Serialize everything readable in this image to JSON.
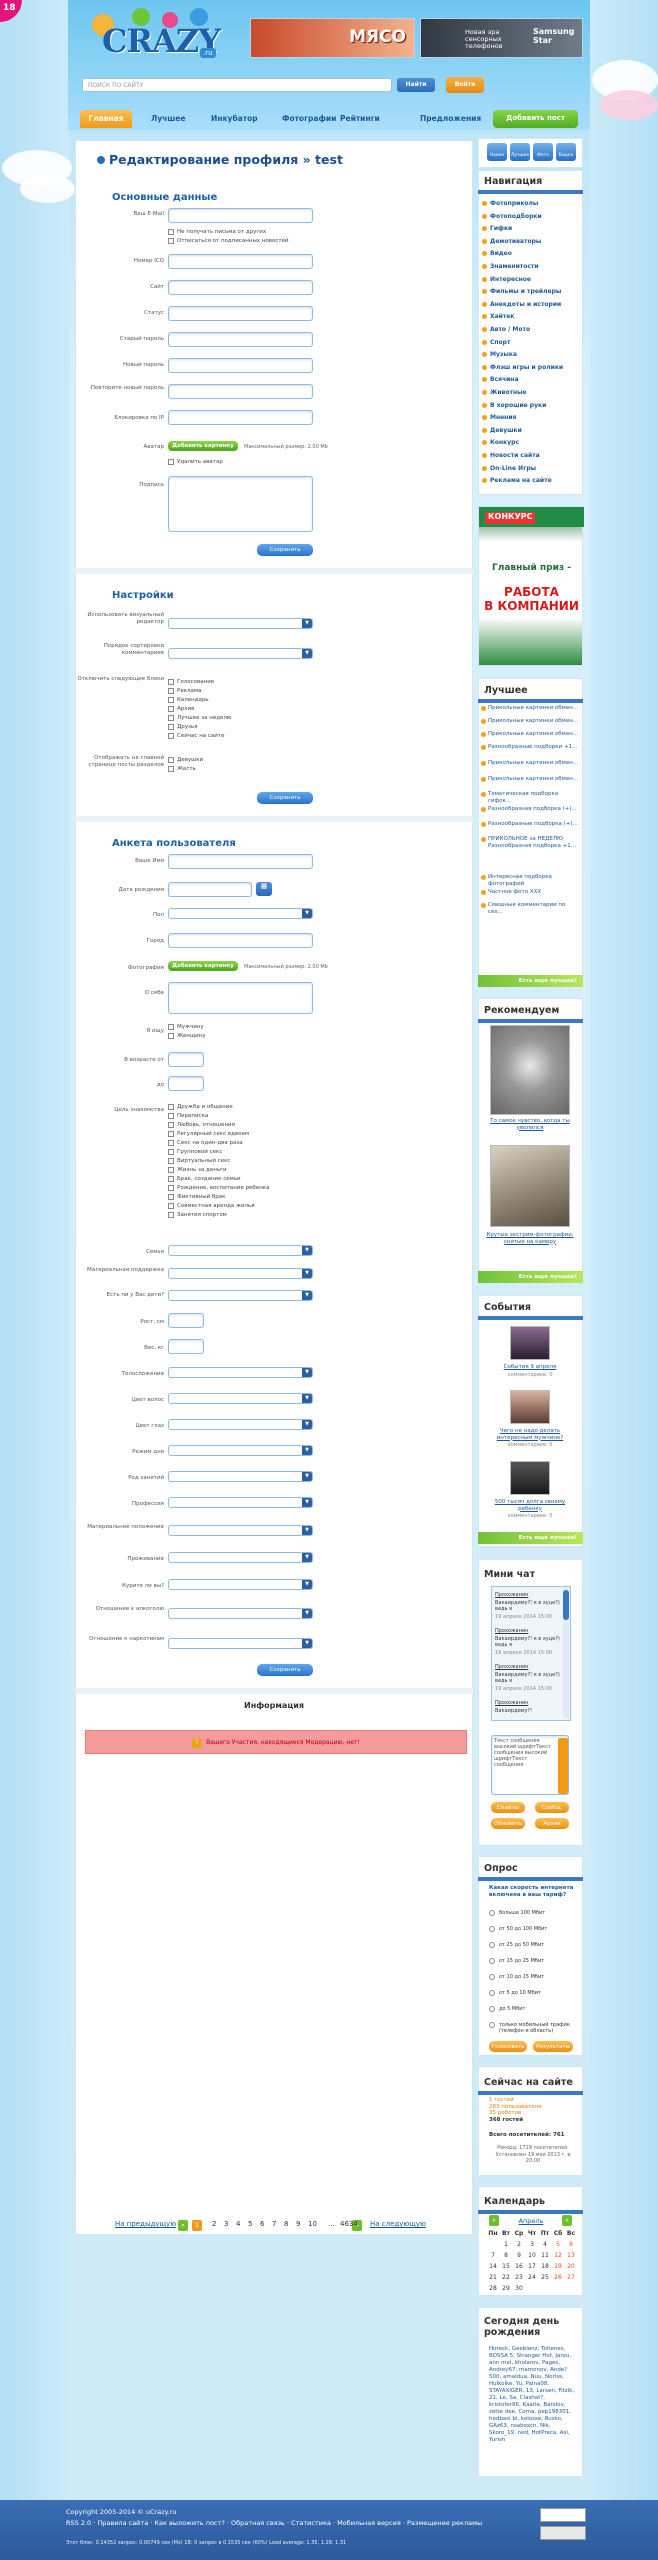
{
  "age_badge": "18",
  "site": {
    "logo": "CRAZY",
    "logo_suffix": ".ru",
    "logo_prefix": "u"
  },
  "ads": {
    "banner1": "МЯСО",
    "banner2_text": "Новая эра\nсенсорных телефонов",
    "banner2_brand": "Samsung\nStar"
  },
  "search": {
    "placeholder": "ПОИСК ПО САЙТУ",
    "find": "Найти"
  },
  "login_button": "Войти",
  "nav": {
    "items": [
      "Главная",
      "Лучшее",
      "Инкубатор",
      "Фотографии",
      "Рейтинги",
      "Предложения"
    ],
    "add_post": "Добавить пост"
  },
  "page": {
    "title": "Редактирование профиля » test",
    "save": "Сохранить"
  },
  "basic": {
    "heading": "Основные данные",
    "labels": [
      "Ваш E-Mail",
      "Номер ICQ",
      "Сайт",
      "Статус",
      "Старый пароль",
      "Новый пароль",
      "Повторите новый пароль",
      "Блокировка по IP",
      "Аватар",
      "Подпись"
    ],
    "checks": [
      "Не получать письма от других",
      "Отписаться от подписанных новостей"
    ],
    "add_photo": "Добавить картинку",
    "max_size": "Максимальный размер: 2.00 Mb",
    "delete_avatar": "Удалить аватар"
  },
  "settings": {
    "heading": "Настройки",
    "labels": [
      "Использовать визуальный редактор",
      "Порядок сортировки комментариев",
      "Отключить следующие блоки",
      "Отображать на главной странице посты разделов"
    ],
    "blocks": [
      "Голосование",
      "Реклама",
      "Календарь",
      "Архив",
      "Лучшее за неделю",
      "Друзья",
      "Сейчас на сайте"
    ],
    "sections": [
      "Девушки",
      "Жесть"
    ]
  },
  "questionnaire": {
    "heading": "Анкета пользователя",
    "labels": [
      "Ваше Имя",
      "Дата рождения",
      "Пол",
      "Город",
      "Фотография",
      "О себе",
      "Я ищу",
      "В возрасте от",
      "до",
      "Цель знакомства",
      "Семья",
      "Материальная поддержка",
      "Есть ли у Вас дети?",
      "Рост, см",
      "Вес, кг",
      "Телосложение",
      "Цвет волос",
      "Цвет глаз",
      "Режим дня",
      "Род занятий",
      "Профессия",
      "Материальное положение",
      "Проживание",
      "Курите ли вы?",
      "Отношение к алкоголю",
      "Отношение к наркотикам"
    ],
    "seek": [
      "Мужчину",
      "Женщину"
    ],
    "goals": [
      "Дружба и общение",
      "Переписка",
      "Любовь, отношения",
      "Регулярный секс вдвоем",
      "Секс на один-два раза",
      "Групповой секс",
      "Виртуальный секс",
      "Жизнь за деньги",
      "Брак, создание семьи",
      "Рождение, воспитание ребенка",
      "Фиктивный брак",
      "Совместная аренда жилья",
      "Занятия спортом"
    ]
  },
  "info": {
    "title": "Информация",
    "warning": "Вашего Участия, находящиеся Модерацию, нет!"
  },
  "pager": {
    "prev": "На предыдущую",
    "current": "1",
    "pages": [
      "2",
      "3",
      "4",
      "5",
      "6",
      "7",
      "8",
      "9",
      "10",
      "...",
      "4634"
    ],
    "next": "На следующую"
  },
  "sidebar": {
    "quick_icons": [
      "Новое",
      "Лучшее",
      "Фото",
      "Видео"
    ],
    "navigation": {
      "title": "Навигация",
      "items": [
        "Фотоприколы",
        "Фотоподборки",
        "Гифки",
        "Демотиваторы",
        "Видео",
        "Знаменитости",
        "Интересное",
        "Фильмы и трейлеры",
        "Анекдоты и истории",
        "Хайтек",
        "Авто / Мото",
        "Спорт",
        "Музыка",
        "Флэш игры и ролики",
        "Всячина",
        "Животные",
        "В хорошие руки",
        "Мнения",
        "Девушки",
        "Конкурс",
        "Новости сайта",
        "On-Line Игры",
        "Реклама на сайте"
      ]
    },
    "contest_banner": {
      "brand": "КОНКУРС",
      "prize": "Главный приз -",
      "job": "РАБОТА\nВ КОМПАНИИ"
    },
    "best": {
      "title": "Лучшее",
      "items": [
        "Прикольные картинки обмен...",
        "Прикольные картинки обмен...",
        "Прикольные картинки обмен...",
        "Разнообразные подборки +1...",
        "Прикольные картинки обмен...",
        "Прикольные картинки обмен...",
        "Тематическая подборка гифок...",
        "Разнообразная подборка (+)...",
        "Разнообразные подборка (+)...",
        "ПРИКОЛЬНОЕ за НЕДЕЛЮ Разнообразная подборка +1...",
        "Интересная подборка фотографий",
        "Частное фото XXX",
        "Смешные комментарии по сех..."
      ],
      "more": "Есть еще лучшее!"
    },
    "recommend": {
      "title": "Рекомендуем",
      "items": [
        "То самое чувство, когда ты уволился",
        "Крутые экстрим-фотографии, снятые на камеру"
      ],
      "more": "Есть еще лучшее!"
    },
    "events": {
      "title": "События",
      "items": [
        "События 9 апреля",
        "Чего не надо делать интересным мужчине?",
        "500 тысяч долга своему ребенку"
      ],
      "meta": "комментариев: 0",
      "more": "Есть еще лучшее!"
    },
    "chat": {
      "title": "Мини чат",
      "messages": [
        {
          "user": "Прохожанин",
          "text": "Вакаирдиму?! я в хуце?) ведь я",
          "time": "19 апреля 2014 15:00"
        },
        {
          "user": "Прохожанин",
          "text": "Вакаирдиму?! я в хуце?) ведь я",
          "time": "19 апреля 2014 15:00"
        },
        {
          "user": "Прохожанин",
          "text": "Вакаирдиму?! я в хуце?) ведь я",
          "time": "19 апреля 2014 15:00"
        },
        {
          "user": "Прохожанин",
          "text": "Вакаирдиму?!",
          "time": ""
        }
      ],
      "input_text": "Текст сообщения высокий шрифтТекст сообщения высокий шрифтТекст сообщения",
      "send": "Сообщ.",
      "refresh": "Обновить",
      "archive": "Архив",
      "smiles": "Смайлы"
    },
    "poll": {
      "title": "Опрос",
      "question": "Какая скорость интернета включена в ваш тариф?",
      "options": [
        "больше 100 Мбит",
        "от 50 до 100 Мбит",
        "от 25 до 50 Мбит",
        "от 15 до 25 Мбит",
        "от 10 до 15 Мбит",
        "от 5 до 10 Мбит",
        "до 5 Мбит",
        "только мобильный трафик (телефон и область)"
      ],
      "vote": "Голосовать",
      "results": "Результаты"
    },
    "online": {
      "title": "Сейчас на сайте",
      "lines": [
        "1 гостей",
        "283 пользователя",
        "35 роботов",
        "368 гостей"
      ],
      "total": "Всего посетителей: 761",
      "record": "Рекорд: 1719 посетителей. Установлен 19 мая 2013 г. в 20:00"
    },
    "calendar": {
      "title": "Календарь",
      "month": "Апрель",
      "days": [
        "Пн",
        "Вт",
        "Ср",
        "Чт",
        "Пт",
        "Сб",
        "Вс"
      ],
      "weeks": [
        [
          "",
          "1",
          "2",
          "3",
          "4",
          "5",
          "6"
        ],
        [
          "7",
          "8",
          "9",
          "10",
          "11",
          "12",
          "13"
        ],
        [
          "14",
          "15",
          "16",
          "17",
          "18",
          "19",
          "20"
        ],
        [
          "21",
          "22",
          "23",
          "24",
          "25",
          "26",
          "27"
        ],
        [
          "28",
          "29",
          "30",
          "",
          "",
          "",
          ""
        ]
      ]
    },
    "birthdays": {
      "title": "Сегодня день рождения",
      "names": "Horeck, Geeblanz, Toltenes, BOSSA 5, Stranger Hot, Jarou, ann mel, kholarov, Pages, Andrey67, mamonov, Ande? 500, amaldua, Nuu, Noriss, Hulkolke, Yu, Palna08, STAYAXIGER, 13, Larsen, Fitzik, 21, Le, Sa, Clashat?, kristofer86, Kaarle, Barslov, zette dee, Coma, pep198301, hodbasi bi, kolosse, Rusko, GAz63, nsaboxcn, Nik, Skoro_19, ned, HotPreca, Asi, Yurish"
    }
  },
  "footer": {
    "copyright": "Copyright 2005-2014 © uCrazy.ru",
    "links": "RSS 2.0 · Правила сайта · Как выложить пост? · Обратная связь · Статистика · Мобильная версия · Размещение рекламы",
    "stats": "Этот блок: 0.14352 запрос: 0.00749 сек (Ms) 1B: 0 запрос в 0.1535 сек (60%) Load average: 1.35, 1.28, 1.31"
  },
  "colors": {
    "brand_blue": "#1d5fa8",
    "accent_orange": "#f29a17",
    "accent_green": "#52ab1e",
    "footer_blue": "#2c5999"
  }
}
